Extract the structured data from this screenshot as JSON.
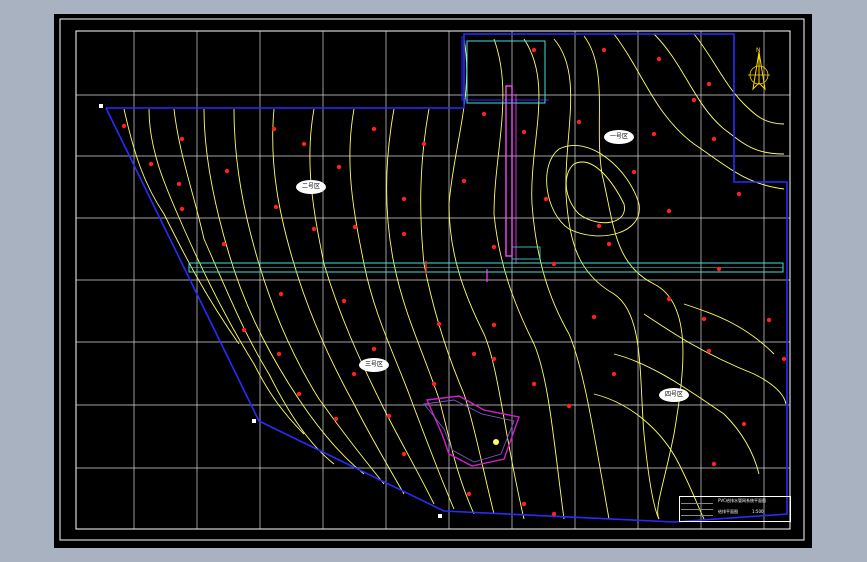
{
  "zones": [
    {
      "id": "zone-1",
      "label": "一号区"
    },
    {
      "id": "zone-2",
      "label": "二号区"
    },
    {
      "id": "zone-3",
      "label": "三号区"
    },
    {
      "id": "zone-4",
      "label": "四号区"
    }
  ],
  "north_arrow": {
    "label": "N"
  },
  "title_block": {
    "title": "PVC给排水管网系统平面图",
    "drawing_name": "给排平面图",
    "scale": "1:500"
  },
  "colors": {
    "background": "#000000",
    "sheet_frame": "#ffffff",
    "grid": "#ffffff",
    "site_boundary": "#2a2aff",
    "contours": "#ffff66",
    "pipe_corridor": "#3fe0e0",
    "main_pipe": "#ff44ff",
    "sprinklers": "#ff2020",
    "pond": "#d020d0",
    "window_chrome": "#a9b2c0"
  },
  "icons": [
    "north-arrow-icon",
    "sprinkler-icon"
  ]
}
